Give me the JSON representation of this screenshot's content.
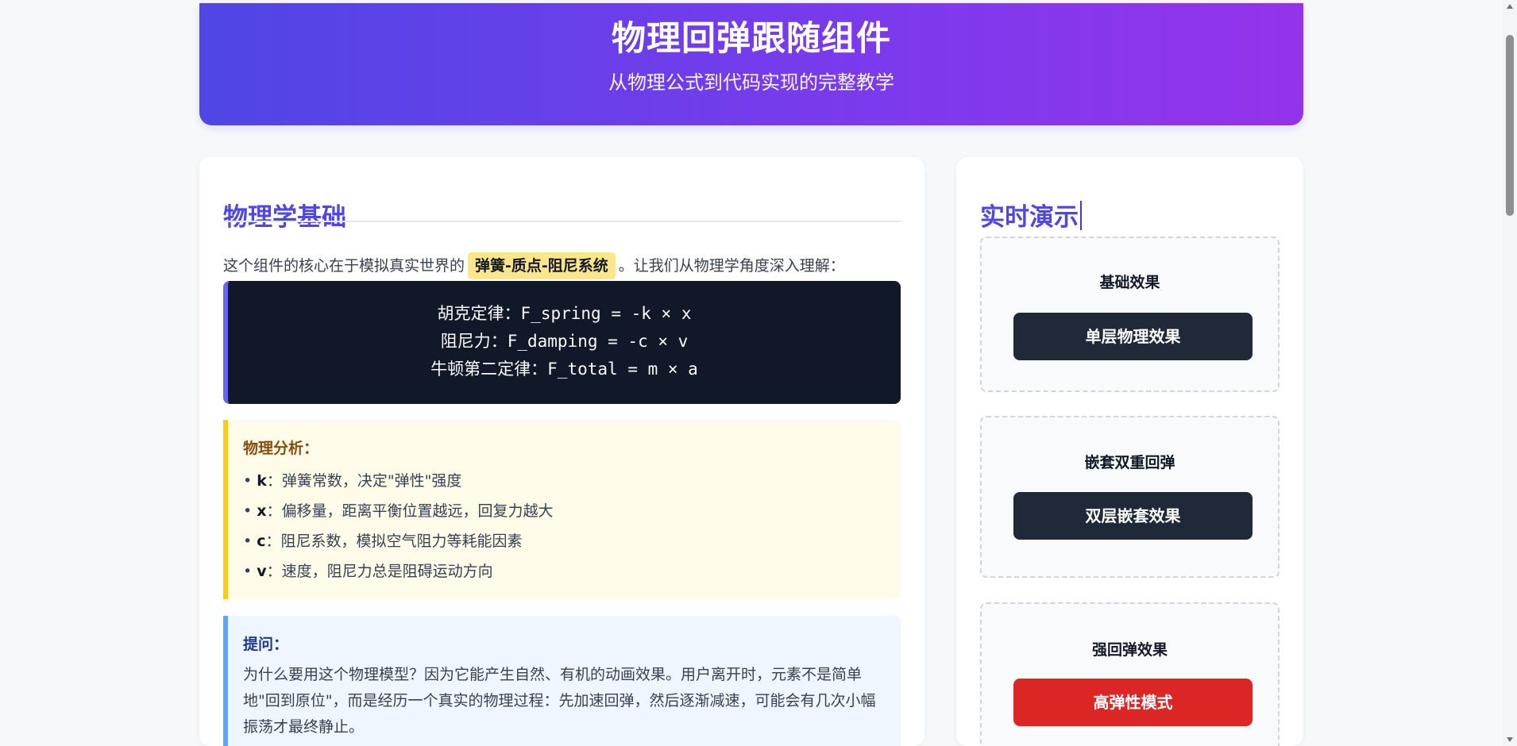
{
  "hero": {
    "title": "物理回弹跟随组件",
    "subtitle": "从物理公式到代码实现的完整教学"
  },
  "physics_section": {
    "title": "物理学基础",
    "intro_before": "这个组件的核心在于模拟真实世界的",
    "intro_highlight": "弹簧-质点-阻尼系统",
    "intro_after": "。让我们从物理学角度深入理解：",
    "formulas": [
      "胡克定律：F_spring = -k × x",
      "阻尼力：F_damping = -c × v",
      "牛顿第二定律：F_total = m × a"
    ],
    "analysis": {
      "title": "物理分析：",
      "items": [
        {
          "bullet": "• ",
          "term": "k",
          "text": "：弹簧常数，决定\"弹性\"强度"
        },
        {
          "bullet": "• ",
          "term": "x",
          "text": "：偏移量，距离平衡位置越远，回复力越大"
        },
        {
          "bullet": "• ",
          "term": "c",
          "text": "：阻尼系数，模拟空气阻力等耗能因素"
        },
        {
          "bullet": "• ",
          "term": "v",
          "text": "：速度，阻尼力总是阻碍运动方向"
        }
      ]
    },
    "question": {
      "title": "提问：",
      "text": "为什么要用这个物理模型？因为它能产生自然、有机的动画效果。用户离开时，元素不是简单地\"回到原位\"，而是经历一个真实的物理过程：先加速回弹，然后逐渐减速，可能会有几次小幅振荡才最终静止。"
    }
  },
  "demo_section": {
    "title": "实时演示",
    "cards": [
      {
        "label": "基础效果",
        "button": "单层物理效果"
      },
      {
        "label": "嵌套双重回弹",
        "button": "双层嵌套效果"
      },
      {
        "label": "强回弹效果",
        "button": "高弹性模式"
      }
    ]
  },
  "colors": {
    "hero_gradient_start": "#4f46e5",
    "hero_gradient_end": "#9333ea",
    "heading": "#4f46e5",
    "formula_bg": "#111827",
    "highlight": "#fde68a",
    "analysis_border": "#facc15",
    "question_border": "#60a5fa",
    "demo_button_dark": "#1f2937",
    "demo_button_red": "#dc2626"
  }
}
